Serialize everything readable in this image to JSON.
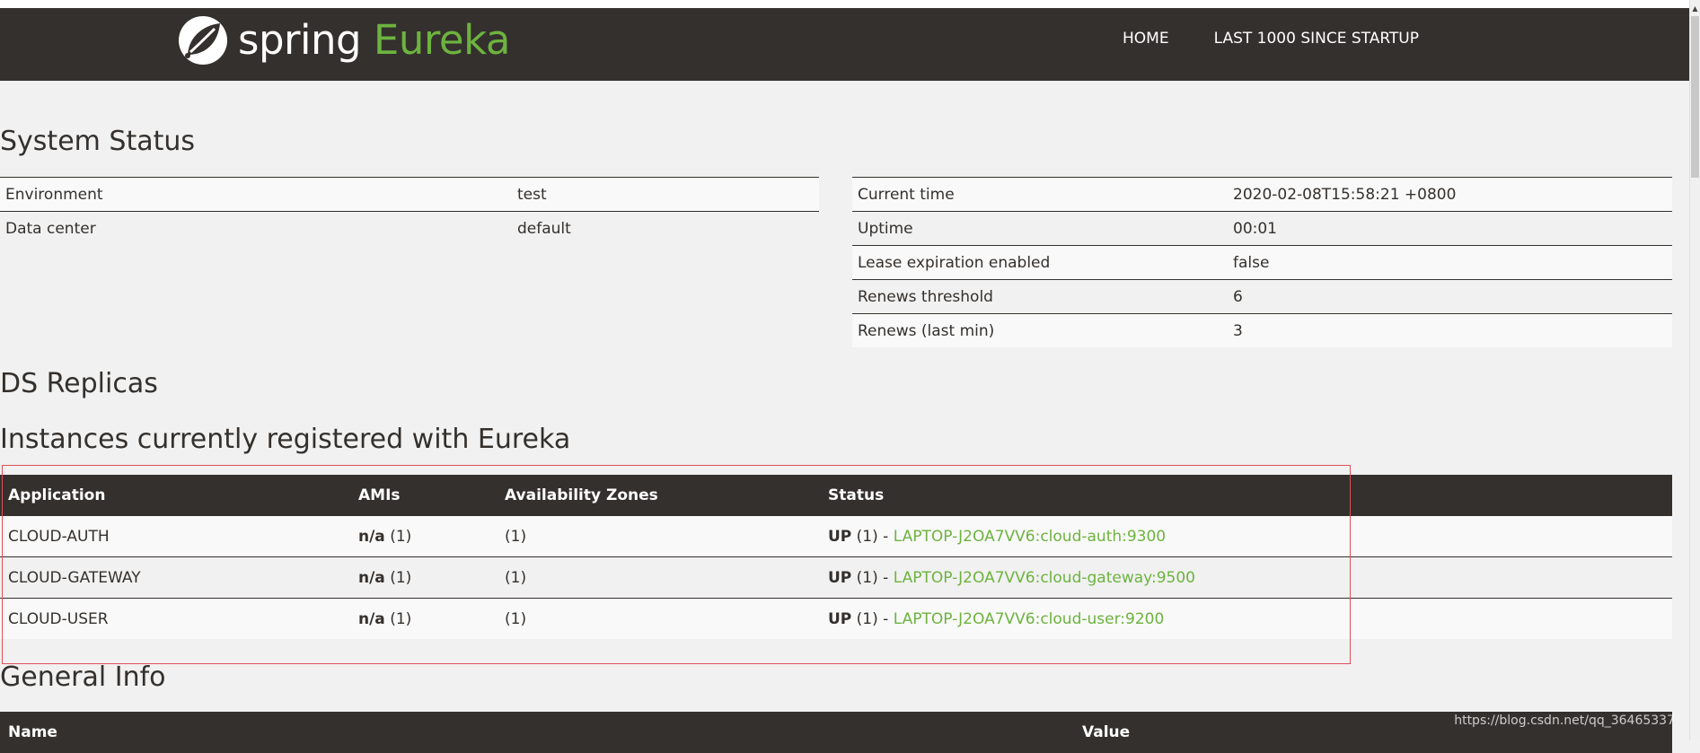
{
  "header": {
    "brand_spring": "spring",
    "brand_eureka": "Eureka",
    "nav": [
      {
        "label": "HOME"
      },
      {
        "label": "LAST 1000 SINCE STARTUP"
      }
    ]
  },
  "system_status": {
    "title": "System Status",
    "left": [
      {
        "key": "Environment",
        "value": "test"
      },
      {
        "key": "Data center",
        "value": "default"
      }
    ],
    "right": [
      {
        "key": "Current time",
        "value": "2020-02-08T15:58:21 +0800"
      },
      {
        "key": "Uptime",
        "value": "00:01"
      },
      {
        "key": "Lease expiration enabled",
        "value": "false"
      },
      {
        "key": "Renews threshold",
        "value": "6"
      },
      {
        "key": "Renews (last min)",
        "value": "3"
      }
    ]
  },
  "ds_replicas": {
    "title": "DS Replicas"
  },
  "instances": {
    "title": "Instances currently registered with Eureka",
    "columns": [
      "Application",
      "AMIs",
      "Availability Zones",
      "Status"
    ],
    "rows": [
      {
        "application": "CLOUD-AUTH",
        "amis_label": "n/a",
        "amis_count": "(1)",
        "zones": "(1)",
        "status_label": "UP",
        "status_count": "(1) -",
        "instance": "LAPTOP-J2OA7VV6:cloud-auth:9300"
      },
      {
        "application": "CLOUD-GATEWAY",
        "amis_label": "n/a",
        "amis_count": "(1)",
        "zones": "(1)",
        "status_label": "UP",
        "status_count": "(1) -",
        "instance": "LAPTOP-J2OA7VV6:cloud-gateway:9500"
      },
      {
        "application": "CLOUD-USER",
        "amis_label": "n/a",
        "amis_count": "(1)",
        "zones": "(1)",
        "status_label": "UP",
        "status_count": "(1) -",
        "instance": "LAPTOP-J2OA7VV6:cloud-user:9200"
      }
    ]
  },
  "general_info": {
    "title": "General Info",
    "columns": [
      "Name",
      "Value"
    ]
  },
  "watermark": "https://blog.csdn.net/qq_36465337",
  "colors": {
    "brand_dark": "#34302d",
    "brand_green": "#6db33f",
    "page_bg": "#f1f1f1",
    "highlight_box": "#e0505a"
  }
}
